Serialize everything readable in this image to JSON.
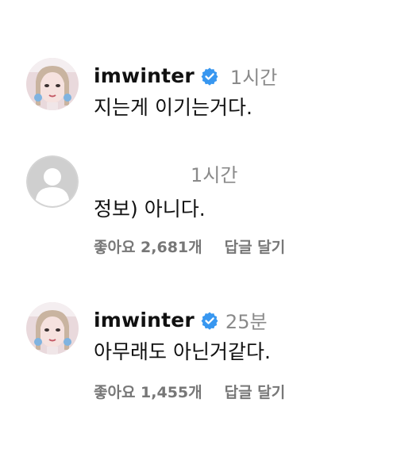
{
  "comments": [
    {
      "username": "imwinter",
      "verified": true,
      "avatar": "profile-photo",
      "time": "1시간",
      "text": "지는게 이기는거다."
    },
    {
      "username": "",
      "verified": false,
      "avatar": "default-avatar",
      "time": "1시간",
      "text": "정보) 아니다.",
      "likes": "좋아요 2,681개",
      "reply": "답글 달기"
    },
    {
      "username": "imwinter",
      "verified": true,
      "avatar": "profile-photo",
      "time": "25분",
      "text": "아무래도 아닌거같다.",
      "likes": "좋아요 1,455개",
      "reply": "답글 달기"
    }
  ],
  "colors": {
    "verified_blue": "#3897f0",
    "time_gray": "#8a8a8a",
    "action_gray": "#777777",
    "text": "#111111",
    "default_avatar_bg": "#c7c7c7"
  }
}
